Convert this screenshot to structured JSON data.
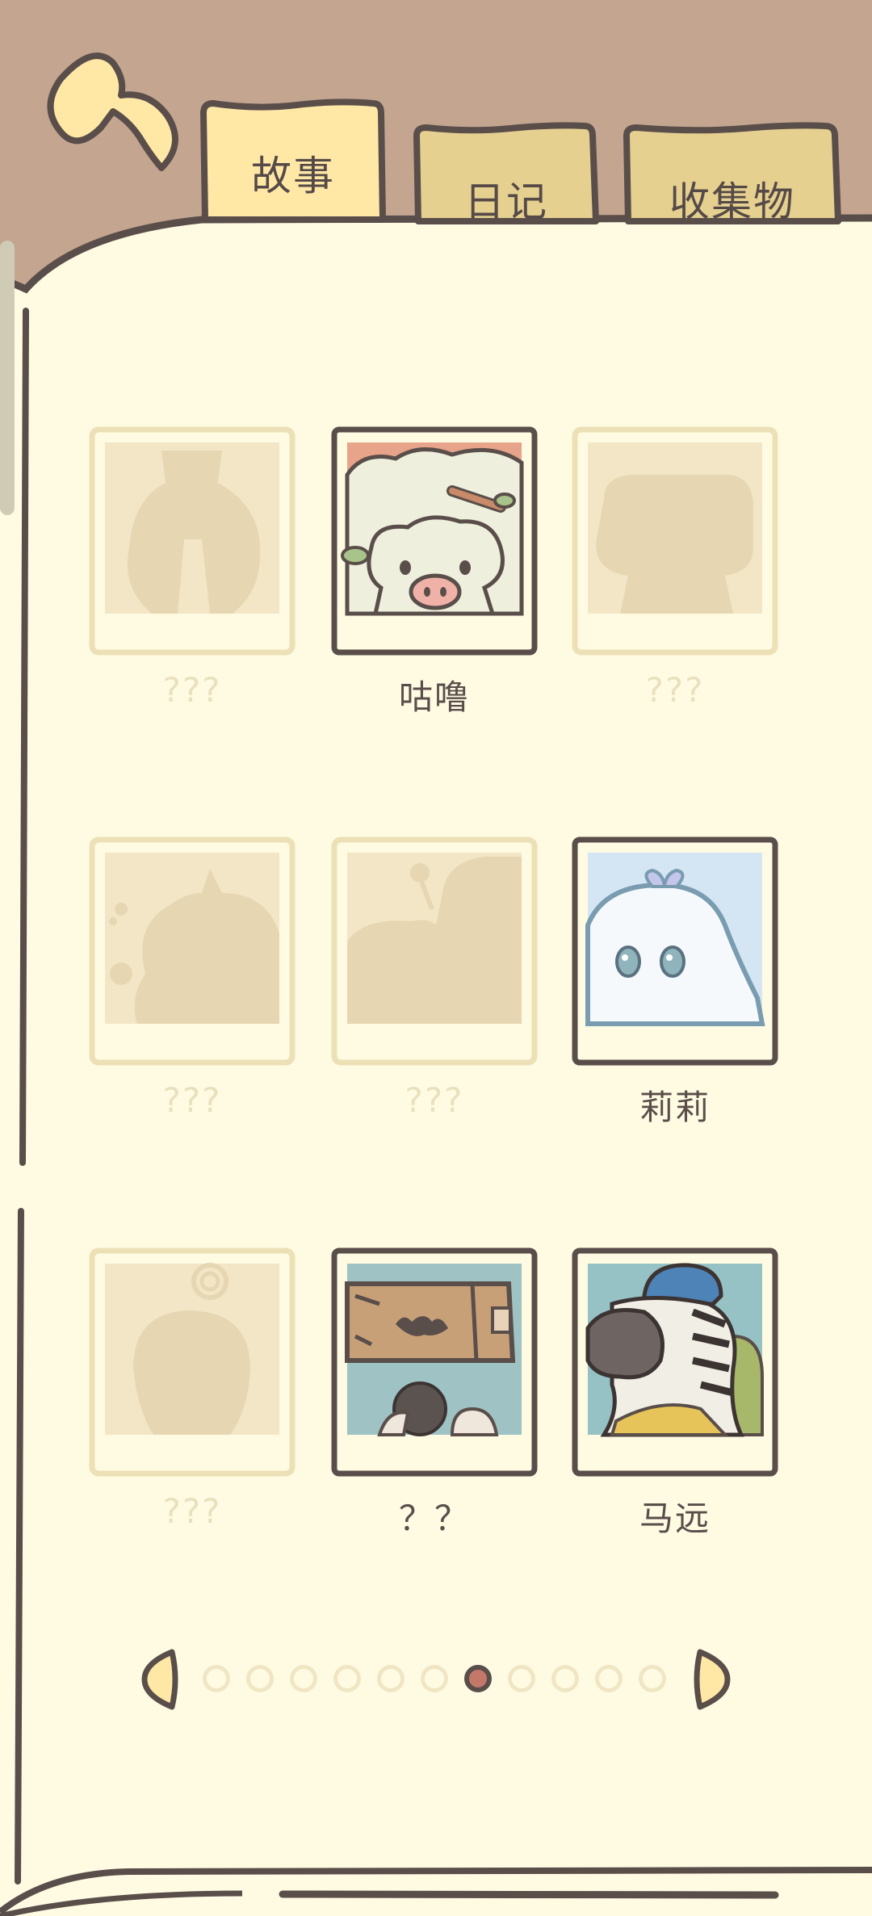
{
  "tabs": [
    {
      "label": "故事",
      "active": true
    },
    {
      "label": "日记",
      "active": false
    },
    {
      "label": "收集物",
      "active": false
    }
  ],
  "characters": [
    {
      "name": "???",
      "unlocked": false,
      "silhouette": "pot-shape"
    },
    {
      "name": "咕噜",
      "unlocked": true,
      "portrait": "sheep-portrait"
    },
    {
      "name": "???",
      "unlocked": false,
      "silhouette": "cloud-shape"
    },
    {
      "name": "???",
      "unlocked": false,
      "silhouette": "round-creature"
    },
    {
      "name": "???",
      "unlocked": false,
      "silhouette": "snail-shape"
    },
    {
      "name": "莉莉",
      "unlocked": true,
      "portrait": "ghost-portrait"
    },
    {
      "name": "???",
      "unlocked": false,
      "silhouette": "apple-shape"
    },
    {
      "name": "？？",
      "unlocked": true,
      "portrait": "box-creature-portrait"
    },
    {
      "name": "马远",
      "unlocked": true,
      "portrait": "zebra-portrait"
    }
  ],
  "pagination": {
    "total_pages": 11,
    "current_page": 7
  },
  "colors": {
    "background": "#c4a690",
    "paper": "#fffbe3",
    "outline": "#5a4e4a",
    "tab_active": "#ffe8a6",
    "tab_inactive": "#e6d090",
    "locked_frame": "#ece0b6",
    "silhouette": "#e6d7b2",
    "active_dot": "#c4786a"
  }
}
